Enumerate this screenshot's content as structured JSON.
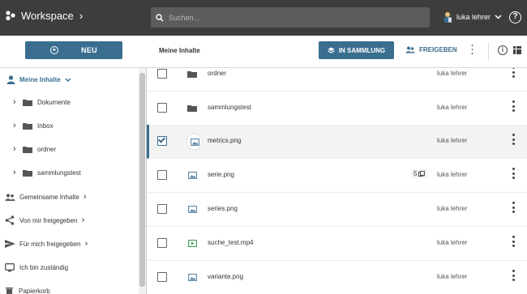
{
  "header": {
    "app_title": "Workspace",
    "search_placeholder": "Suchen...",
    "user_name": "luka lehrer"
  },
  "toolbar": {
    "new_label": "NEU",
    "breadcrumb": "Meine Inhalte",
    "collection_label": "IN SAMMLUNG",
    "share_label": "FREIGEBEN"
  },
  "sidebar": {
    "my_content": "Meine Inhalte",
    "folders": [
      {
        "label": "Dokumente"
      },
      {
        "label": "Inbox"
      },
      {
        "label": "ordner"
      },
      {
        "label": "sammlungstest"
      }
    ],
    "shared_content": "Gemeinsame Inhalte",
    "shared_by_me": "Von mir freigegeben",
    "shared_with_me": "Für mich freigegeben",
    "responsible": "Ich bin zuständig",
    "trash": "Papierkorb"
  },
  "files": [
    {
      "name": "ordner",
      "owner": "luka lehrer",
      "type": "folder",
      "selected": false
    },
    {
      "name": "sammlungstest",
      "owner": "luka lehrer",
      "type": "folder",
      "selected": false
    },
    {
      "name": "metrics.png",
      "owner": "luka lehrer",
      "type": "image",
      "selected": true
    },
    {
      "name": "serie.png",
      "owner": "luka lehrer",
      "type": "image",
      "selected": false,
      "versions": "5"
    },
    {
      "name": "series.png",
      "owner": "luka lehrer",
      "type": "image",
      "selected": false
    },
    {
      "name": "suche_test.mp4",
      "owner": "luka lehrer",
      "type": "video",
      "selected": false
    },
    {
      "name": "variante.png",
      "owner": "luka lehrer",
      "type": "image",
      "selected": false
    }
  ],
  "colors": {
    "accent": "#3a6e8f",
    "topbar": "#3d3d3d"
  }
}
